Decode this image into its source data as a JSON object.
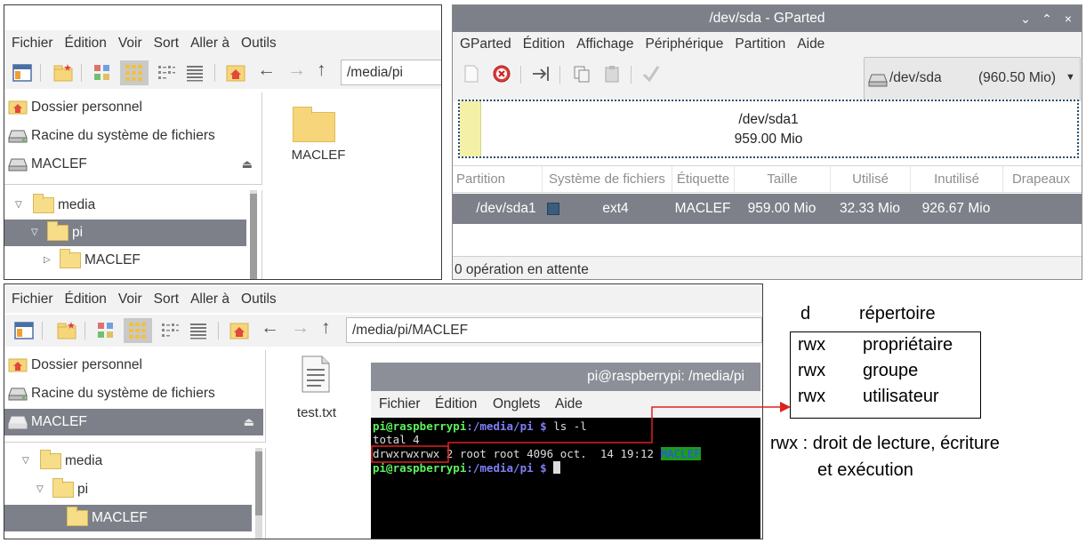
{
  "fm1": {
    "menu": [
      "Fichier",
      "Édition",
      "Voir",
      "Sort",
      "Aller à",
      "Outils"
    ],
    "path": "/media/pi",
    "places": [
      {
        "label": "Dossier personnel",
        "icon": "home-icon"
      },
      {
        "label": "Racine du système de fichiers",
        "icon": "drive-icon"
      },
      {
        "label": "MACLEF",
        "icon": "usb-drive-icon"
      }
    ],
    "tree": [
      {
        "label": "media",
        "twisty": "▽"
      },
      {
        "label": "pi",
        "twisty": "▽"
      },
      {
        "label": "MACLEF",
        "twisty": "▷"
      }
    ],
    "content_item": "MACLEF"
  },
  "gparted": {
    "title": "/dev/sda - GParted",
    "window_buttons": [
      "⌄",
      "⌃",
      "×"
    ],
    "menu": [
      "GParted",
      "Édition",
      "Affichage",
      "Périphérique",
      "Partition",
      "Aide"
    ],
    "device": "/dev/sda",
    "device_size": "(960.50 Mio)",
    "partmap_name": "/dev/sda1",
    "partmap_size": "959.00 Mio",
    "columns": [
      "Partition",
      "Système de fichiers",
      "Étiquette",
      "Taille",
      "Utilisé",
      "Inutilisé",
      "Drapeaux"
    ],
    "row": {
      "partition": "/dev/sda1",
      "fs": "ext4",
      "label": "MACLEF",
      "size": "959.00 Mio",
      "used": "32.33 Mio",
      "unused": "926.67 Mio",
      "flags": ""
    },
    "status": "0 opération en attente",
    "colors": {
      "ext4": "#3a5c7e",
      "selection": "#7d8089"
    }
  },
  "fm2": {
    "menu": [
      "Fichier",
      "Édition",
      "Voir",
      "Sort",
      "Aller à",
      "Outils"
    ],
    "path": "/media/pi/MACLEF",
    "places": [
      {
        "label": "Dossier personnel",
        "icon": "home-icon"
      },
      {
        "label": "Racine du système de fichiers",
        "icon": "drive-icon"
      },
      {
        "label": "MACLEF",
        "icon": "usb-drive-icon"
      }
    ],
    "tree": [
      {
        "label": "media",
        "twisty": "▽"
      },
      {
        "label": "pi",
        "twisty": "▽"
      },
      {
        "label": "MACLEF",
        "twisty": ""
      }
    ],
    "content_item": "test.txt"
  },
  "terminal": {
    "title": "pi@raspberrypi: /media/pi",
    "menu": [
      "Fichier",
      "Édition",
      "Onglets",
      "Aide"
    ],
    "prompt_user": "pi@raspberrypi",
    "prompt_path": ":/media/pi $",
    "cmd": " ls -l",
    "line2": "total 4",
    "perms": "drwxrwxrwx",
    "line3_rest": " 2 root root 4096 oct.  14 19:12 ",
    "line3_name": "MACLEF"
  },
  "annotation": {
    "d_letter": "d",
    "d_label": "répertoire",
    "rows": [
      {
        "code": "rwx",
        "label": "propriétaire"
      },
      {
        "code": "rwx",
        "label": "groupe"
      },
      {
        "code": "rwx",
        "label": "utilisateur"
      }
    ],
    "note_line1": "rwx : droit de lecture, écriture",
    "note_line2": "et exécution"
  }
}
